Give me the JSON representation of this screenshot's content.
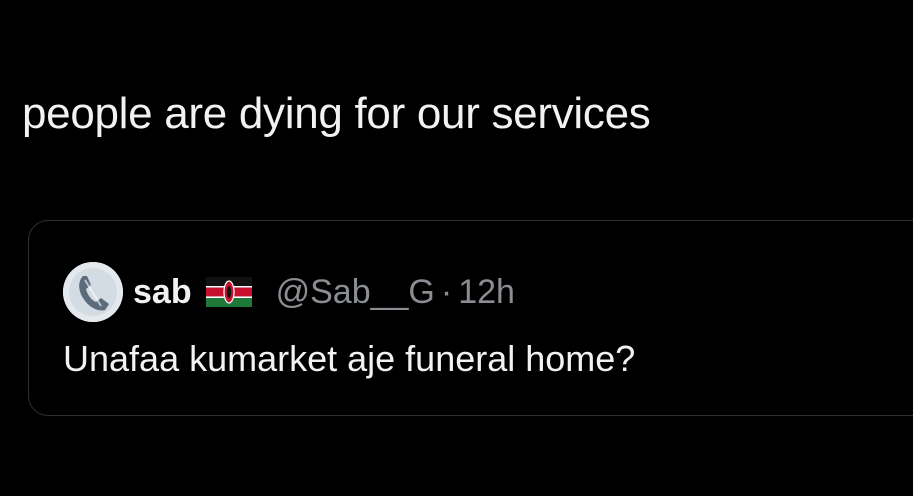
{
  "tweet": {
    "text": "people are dying for our services"
  },
  "quoted_tweet": {
    "avatar_icon": "phone-handset-avatar",
    "display_name": "sab",
    "flag_icon": "kenya-flag-icon",
    "handle": "@Sab__G",
    "separator": "·",
    "timestamp": "12h",
    "text": "Unafaa kumarket aje funeral home?"
  },
  "colors": {
    "background": "#000000",
    "primary_text": "#f2f2f2",
    "secondary_text": "#8a8d91",
    "card_border": "#2c2f33"
  }
}
